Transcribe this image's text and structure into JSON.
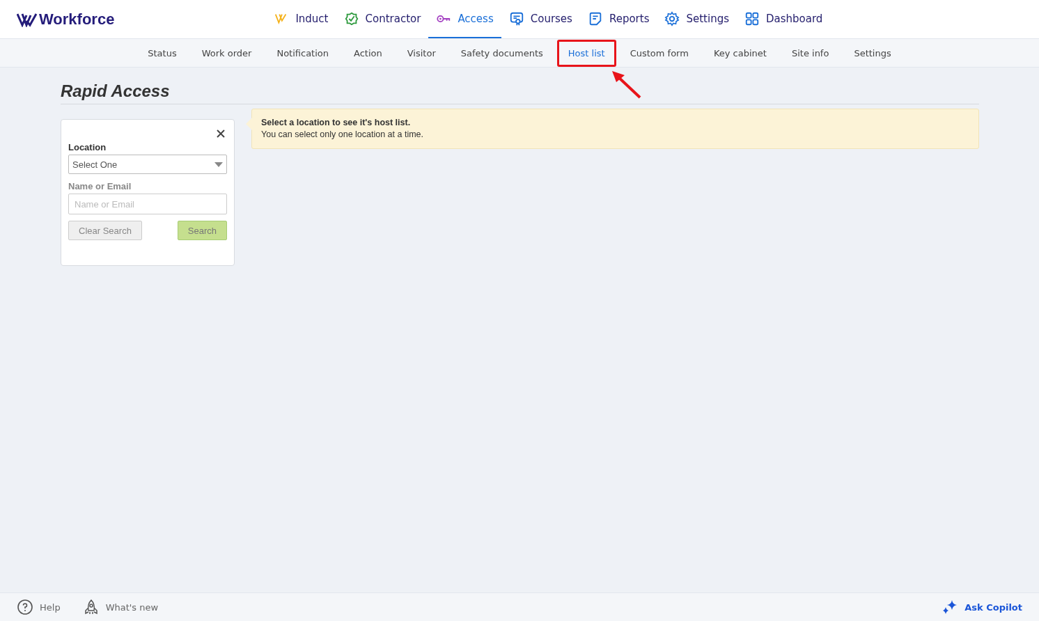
{
  "brand": {
    "name": "Workforce"
  },
  "main_nav": [
    {
      "label": "Induct",
      "kind": "induct",
      "selected": false
    },
    {
      "label": "Contractor",
      "kind": "contractor",
      "selected": false
    },
    {
      "label": "Access",
      "kind": "access",
      "selected": true
    },
    {
      "label": "Courses",
      "kind": "courses",
      "selected": false
    },
    {
      "label": "Reports",
      "kind": "reports",
      "selected": false
    },
    {
      "label": "Settings",
      "kind": "settings",
      "selected": false
    },
    {
      "label": "Dashboard",
      "kind": "dashboard",
      "selected": false
    }
  ],
  "sub_nav": [
    {
      "label": "Status",
      "selected": false,
      "highlighted": false
    },
    {
      "label": "Work order",
      "selected": false,
      "highlighted": false
    },
    {
      "label": "Notification",
      "selected": false,
      "highlighted": false
    },
    {
      "label": "Action",
      "selected": false,
      "highlighted": false
    },
    {
      "label": "Visitor",
      "selected": false,
      "highlighted": false
    },
    {
      "label": "Safety documents",
      "selected": false,
      "highlighted": false
    },
    {
      "label": "Host list",
      "selected": true,
      "highlighted": true
    },
    {
      "label": "Custom form",
      "selected": false,
      "highlighted": false
    },
    {
      "label": "Key cabinet",
      "selected": false,
      "highlighted": false
    },
    {
      "label": "Site info",
      "selected": false,
      "highlighted": false
    },
    {
      "label": "Settings",
      "selected": false,
      "highlighted": false
    }
  ],
  "page_title": "Rapid Access",
  "filter_panel": {
    "location_label": "Location",
    "location_value": "Select One",
    "name_label": "Name or Email",
    "name_placeholder": "Name or Email",
    "clear_button": "Clear Search",
    "search_button": "Search"
  },
  "notice": {
    "title": "Select a location to see it's host list.",
    "text": "You can select only one location at a time."
  },
  "footer": {
    "help": "Help",
    "whats_new": "What's new",
    "copilot": "Ask Copilot"
  }
}
